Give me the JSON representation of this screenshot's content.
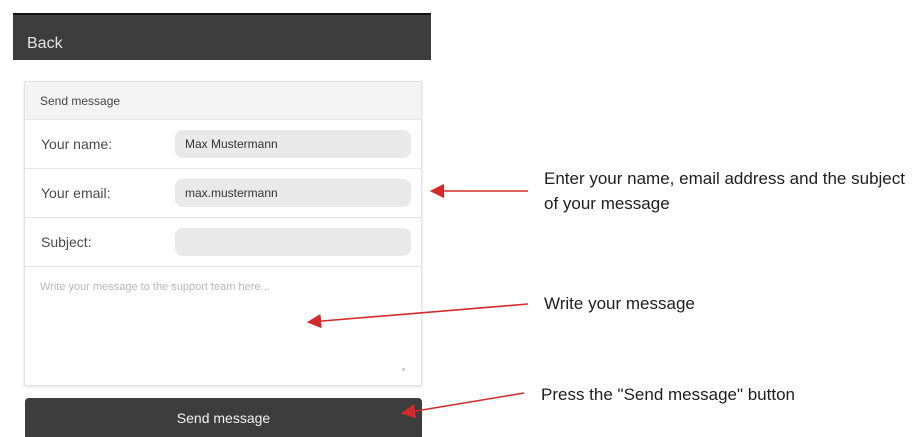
{
  "topbar": {
    "back_label": "Back"
  },
  "form": {
    "header_title": "Send message",
    "fields": [
      {
        "label": "Your name:",
        "value": "Max Mustermann",
        "placeholder": ""
      },
      {
        "label": "Your email:",
        "value": "max.mustermann",
        "placeholder": ""
      },
      {
        "label": "Subject:",
        "value": "",
        "placeholder": ""
      }
    ],
    "message_placeholder": "Write your message to the support team here...",
    "send_button_label": "Send message"
  },
  "annotations": {
    "fields_note": "Enter your name, email address and the subject of your message",
    "message_note": "Write your message",
    "button_note": "Press the \"Send message\" button",
    "arrow_color": "#d42a2a"
  }
}
